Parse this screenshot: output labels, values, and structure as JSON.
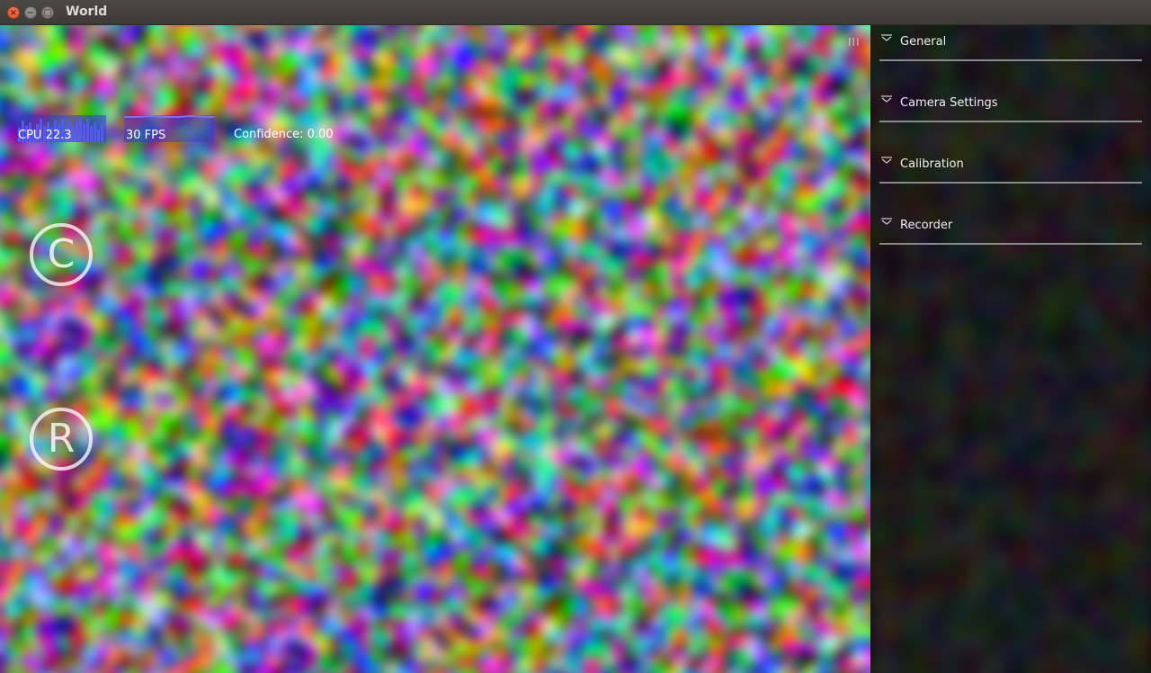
{
  "window": {
    "title": "World",
    "close_glyph": "×",
    "min_glyph": "−",
    "max_glyph": "□"
  },
  "world": {
    "cpu_label": "CPU 22.3",
    "fps_label": "30 FPS",
    "confidence_label": "Confidence: 0.00",
    "calibrate_button_glyph": "C",
    "record_button_glyph": "R",
    "menu_handle_glyph": "III"
  },
  "sidebar": {
    "sections": [
      {
        "label": "General",
        "icon": "chevron-down-icon"
      },
      {
        "label": "Camera Settings",
        "icon": "chevron-down-icon"
      },
      {
        "label": "Calibration",
        "icon": "chevron-down-icon"
      },
      {
        "label": "Recorder",
        "icon": "chevron-down-icon"
      }
    ]
  },
  "colors": {
    "titlebar": "#3c3b37",
    "close_button": "#e0461e",
    "graph_fill": "#3c3cc8",
    "section_divider": "#8a8a8a"
  }
}
